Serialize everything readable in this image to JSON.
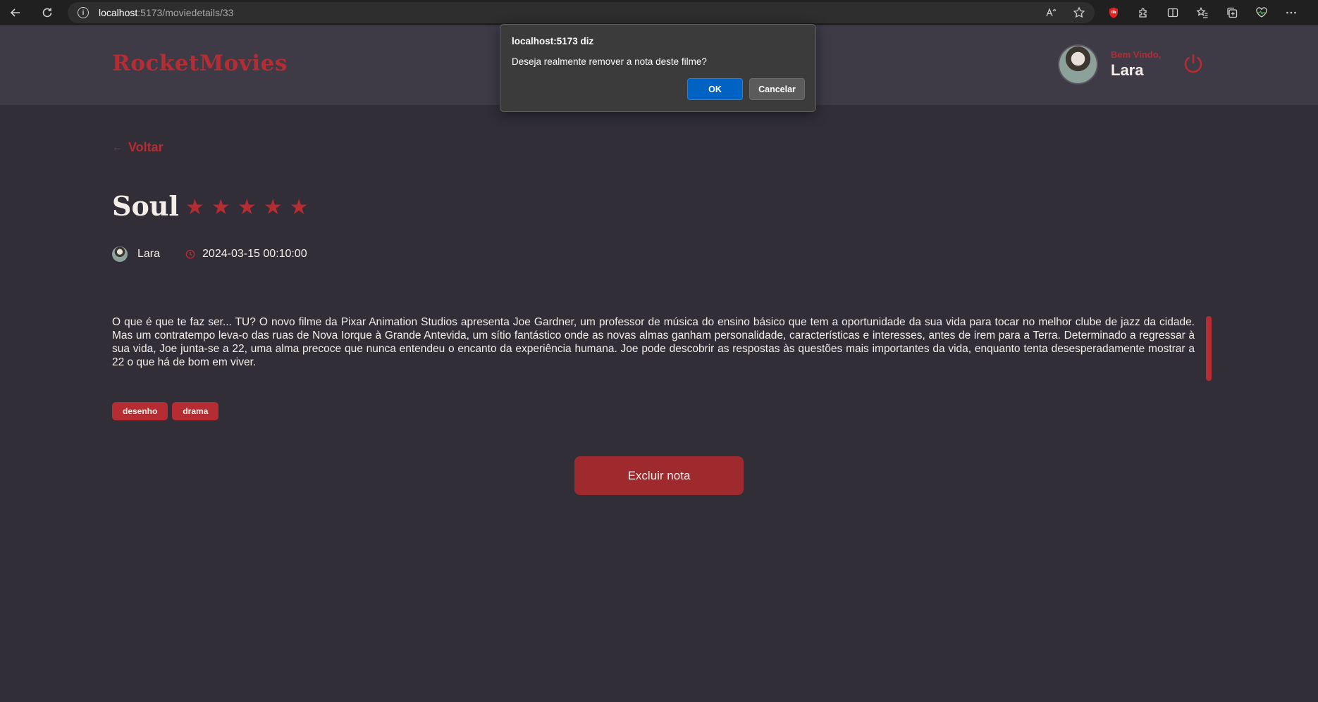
{
  "browser": {
    "url_host": "localhost",
    "url_rest": ":5173/moviedetails/33",
    "icons": [
      "back-icon",
      "refresh-icon",
      "info-icon",
      "read-aloud-icon",
      "favorite-star-icon",
      "extension-red-icon",
      "puzzle-icon",
      "split-screen-icon",
      "favorites-icon",
      "collections-icon",
      "heart-pulse-icon",
      "more-icon"
    ]
  },
  "header": {
    "brand": "RocketMovies",
    "welcome_label": "Bem Vindo,",
    "user_name": "Lara"
  },
  "movie": {
    "back_label": "Voltar",
    "title": "Soul",
    "rating": 5,
    "stars": [
      "★",
      "★",
      "★",
      "★",
      "★"
    ],
    "author": "Lara",
    "datetime": "2024-03-15 00:10:00",
    "description": "O que é que te faz ser... TU? O novo filme da Pixar Animation Studios apresenta Joe Gardner, um professor de música do ensino básico que tem a oportunidade da sua vida para tocar no melhor clube de jazz da cidade. Mas um contratempo leva-o das ruas de Nova Iorque à Grande Antevida, um sítio fantástico onde as novas almas ganham personalidade, características e interesses, antes de irem para a Terra. Determinado a regressar à sua vida, Joe junta-se a 22, uma alma precoce que nunca entendeu o encanto da experiência humana. Joe pode descobrir as respostas às questões mais importantes da vida, enquanto tenta desesperadamente mostrar a 22 o que há de bom em viver.",
    "tags": [
      "desenho",
      "drama"
    ],
    "delete_label": "Excluir nota"
  },
  "dialog": {
    "title": "localhost:5173 diz",
    "message": "Deseja realmente remover a nota deste filme?",
    "ok_label": "OK",
    "cancel_label": "Cancelar"
  },
  "colors": {
    "accent": "#B52C32",
    "background": "#312E38",
    "header_bg": "#3E3B47",
    "dialog_ok": "#0063C3"
  }
}
